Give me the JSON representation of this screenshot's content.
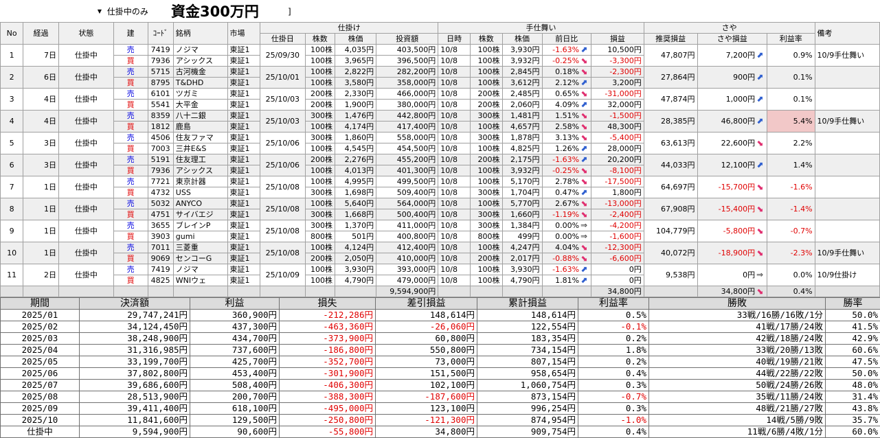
{
  "toolbar": {
    "filter_value": "仕掛中のみ",
    "caption": "資金300万円",
    "filter_right": "]"
  },
  "headers": {
    "no": "No",
    "elapsed": "経過",
    "status": "状態",
    "side": "建",
    "code": "ｺｰﾄﾞ",
    "name": "銘柄",
    "market": "市場",
    "grp_open": "仕掛け",
    "grp_close": "手仕舞い",
    "grp_spread": "さや",
    "open_date": "仕掛日",
    "open_qty": "株数",
    "open_price": "株価",
    "invest": "投資額",
    "close_time": "日時",
    "close_qty": "株数",
    "close_price": "株価",
    "day_change": "前日比",
    "pl": "損益",
    "rec_pl": "推奨損益",
    "spread_pl": "さや損益",
    "rate": "利益率",
    "memo": "備考"
  },
  "positions": [
    {
      "no": "1",
      "elapsed": "7日",
      "status": "仕掛中",
      "open_date": "25/09/30",
      "rec_pl": "47,807円",
      "spread_pl": "7,200円",
      "spread_dir": "up",
      "rate": "0.9%",
      "memo": "10/9手仕舞い",
      "highlight": false,
      "legs": [
        {
          "side": "売",
          "code": "7419",
          "name": "ノジマ",
          "market": "東証1",
          "qty": "100株",
          "price": "4,035円",
          "invest": "403,500円",
          "ctime": "10/8",
          "cqty": "100株",
          "cprice": "3,930円",
          "chg": "-1.63%",
          "dir": "up",
          "pl": "10,500円"
        },
        {
          "side": "買",
          "code": "7936",
          "name": "アシックス",
          "market": "東証1",
          "qty": "100株",
          "price": "3,965円",
          "invest": "396,500円",
          "ctime": "10/8",
          "cqty": "100株",
          "cprice": "3,932円",
          "chg": "-0.25%",
          "dir": "down",
          "pl": "-3,300円"
        }
      ]
    },
    {
      "no": "2",
      "elapsed": "6日",
      "status": "仕掛中",
      "open_date": "25/10/01",
      "rec_pl": "27,864円",
      "spread_pl": "900円",
      "spread_dir": "up",
      "rate": "0.1%",
      "memo": "",
      "highlight": false,
      "legs": [
        {
          "side": "売",
          "code": "5715",
          "name": "古河機金",
          "market": "東証1",
          "qty": "100株",
          "price": "2,822円",
          "invest": "282,200円",
          "ctime": "10/8",
          "cqty": "100株",
          "cprice": "2,845円",
          "chg": "0.18%",
          "dir": "down",
          "pl": "-2,300円"
        },
        {
          "side": "買",
          "code": "8795",
          "name": "T&DHD",
          "market": "東証1",
          "qty": "100株",
          "price": "3,580円",
          "invest": "358,000円",
          "ctime": "10/8",
          "cqty": "100株",
          "cprice": "3,612円",
          "chg": "2.12%",
          "dir": "up",
          "pl": "3,200円"
        }
      ]
    },
    {
      "no": "3",
      "elapsed": "4日",
      "status": "仕掛中",
      "open_date": "25/10/03",
      "rec_pl": "47,874円",
      "spread_pl": "1,000円",
      "spread_dir": "up",
      "rate": "0.1%",
      "memo": "",
      "highlight": false,
      "legs": [
        {
          "side": "売",
          "code": "6101",
          "name": "ツガミ",
          "market": "東証1",
          "qty": "200株",
          "price": "2,330円",
          "invest": "466,000円",
          "ctime": "10/8",
          "cqty": "200株",
          "cprice": "2,485円",
          "chg": "0.65%",
          "dir": "down",
          "pl": "-31,000円"
        },
        {
          "side": "買",
          "code": "5541",
          "name": "大平金",
          "market": "東証1",
          "qty": "200株",
          "price": "1,900円",
          "invest": "380,000円",
          "ctime": "10/8",
          "cqty": "200株",
          "cprice": "2,060円",
          "chg": "4.09%",
          "dir": "up",
          "pl": "32,000円"
        }
      ]
    },
    {
      "no": "4",
      "elapsed": "4日",
      "status": "仕掛中",
      "open_date": "25/10/03",
      "rec_pl": "28,385円",
      "spread_pl": "46,800円",
      "spread_dir": "up",
      "rate": "5.4%",
      "memo": "10/9手仕舞い",
      "highlight": true,
      "legs": [
        {
          "side": "売",
          "code": "8359",
          "name": "八十二銀",
          "market": "東証1",
          "qty": "300株",
          "price": "1,476円",
          "invest": "442,800円",
          "ctime": "10/8",
          "cqty": "300株",
          "cprice": "1,481円",
          "chg": "1.51%",
          "dir": "down",
          "pl": "-1,500円"
        },
        {
          "side": "買",
          "code": "1812",
          "name": "鹿島",
          "market": "東証1",
          "qty": "100株",
          "price": "4,174円",
          "invest": "417,400円",
          "ctime": "10/8",
          "cqty": "100株",
          "cprice": "4,657円",
          "chg": "2.58%",
          "dir": "down",
          "pl": "48,300円"
        }
      ]
    },
    {
      "no": "5",
      "elapsed": "3日",
      "status": "仕掛中",
      "open_date": "25/10/06",
      "rec_pl": "63,613円",
      "spread_pl": "22,600円",
      "spread_dir": "down",
      "rate": "2.2%",
      "memo": "",
      "highlight": false,
      "legs": [
        {
          "side": "売",
          "code": "4506",
          "name": "住友ファマ",
          "market": "東証1",
          "qty": "300株",
          "price": "1,860円",
          "invest": "558,000円",
          "ctime": "10/8",
          "cqty": "300株",
          "cprice": "1,878円",
          "chg": "3.13%",
          "dir": "down",
          "pl": "-5,400円"
        },
        {
          "side": "買",
          "code": "7003",
          "name": "三井E&S",
          "market": "東証1",
          "qty": "100株",
          "price": "4,545円",
          "invest": "454,500円",
          "ctime": "10/8",
          "cqty": "100株",
          "cprice": "4,825円",
          "chg": "1.26%",
          "dir": "up",
          "pl": "28,000円"
        }
      ]
    },
    {
      "no": "6",
      "elapsed": "3日",
      "status": "仕掛中",
      "open_date": "25/10/06",
      "rec_pl": "44,033円",
      "spread_pl": "12,100円",
      "spread_dir": "up",
      "rate": "1.4%",
      "memo": "",
      "highlight": false,
      "legs": [
        {
          "side": "売",
          "code": "5191",
          "name": "住友理工",
          "market": "東証1",
          "qty": "200株",
          "price": "2,276円",
          "invest": "455,200円",
          "ctime": "10/8",
          "cqty": "200株",
          "cprice": "2,175円",
          "chg": "-1.63%",
          "dir": "up",
          "pl": "20,200円"
        },
        {
          "side": "買",
          "code": "7936",
          "name": "アシックス",
          "market": "東証1",
          "qty": "100株",
          "price": "4,013円",
          "invest": "401,300円",
          "ctime": "10/8",
          "cqty": "100株",
          "cprice": "3,932円",
          "chg": "-0.25%",
          "dir": "down",
          "pl": "-8,100円"
        }
      ]
    },
    {
      "no": "7",
      "elapsed": "1日",
      "status": "仕掛中",
      "open_date": "25/10/08",
      "rec_pl": "64,697円",
      "spread_pl": "-15,700円",
      "spread_dir": "down",
      "rate": "-1.6%",
      "memo": "",
      "highlight": false,
      "legs": [
        {
          "side": "売",
          "code": "7721",
          "name": "東京計器",
          "market": "東証1",
          "qty": "100株",
          "price": "4,995円",
          "invest": "499,500円",
          "ctime": "10/8",
          "cqty": "100株",
          "cprice": "5,170円",
          "chg": "2.78%",
          "dir": "down",
          "pl": "-17,500円"
        },
        {
          "side": "買",
          "code": "4732",
          "name": "USS",
          "market": "東証1",
          "qty": "300株",
          "price": "1,698円",
          "invest": "509,400円",
          "ctime": "10/8",
          "cqty": "300株",
          "cprice": "1,704円",
          "chg": "0.47%",
          "dir": "up",
          "pl": "1,800円"
        }
      ]
    },
    {
      "no": "8",
      "elapsed": "1日",
      "status": "仕掛中",
      "open_date": "25/10/08",
      "rec_pl": "67,908円",
      "spread_pl": "-15,400円",
      "spread_dir": "down",
      "rate": "-1.4%",
      "memo": "",
      "highlight": false,
      "legs": [
        {
          "side": "売",
          "code": "5032",
          "name": "ANYCO",
          "market": "東証1",
          "qty": "100株",
          "price": "5,640円",
          "invest": "564,000円",
          "ctime": "10/8",
          "cqty": "100株",
          "cprice": "5,770円",
          "chg": "2.67%",
          "dir": "down",
          "pl": "-13,000円"
        },
        {
          "side": "買",
          "code": "4751",
          "name": "サイバエジ",
          "market": "東証1",
          "qty": "300株",
          "price": "1,668円",
          "invest": "500,400円",
          "ctime": "10/8",
          "cqty": "300株",
          "cprice": "1,660円",
          "chg": "-1.19%",
          "dir": "down",
          "pl": "-2,400円"
        }
      ]
    },
    {
      "no": "9",
      "elapsed": "1日",
      "status": "仕掛中",
      "open_date": "25/10/08",
      "rec_pl": "104,779円",
      "spread_pl": "-5,800円",
      "spread_dir": "down",
      "rate": "-0.7%",
      "memo": "",
      "highlight": false,
      "legs": [
        {
          "side": "売",
          "code": "3655",
          "name": "ブレインP",
          "market": "東証1",
          "qty": "300株",
          "price": "1,370円",
          "invest": "411,000円",
          "ctime": "10/8",
          "cqty": "300株",
          "cprice": "1,384円",
          "chg": "0.00%",
          "dir": "flat",
          "pl": "-4,200円"
        },
        {
          "side": "買",
          "code": "3903",
          "name": "gumi",
          "market": "東証1",
          "qty": "800株",
          "price": "501円",
          "invest": "400,800円",
          "ctime": "10/8",
          "cqty": "800株",
          "cprice": "499円",
          "chg": "0.00%",
          "dir": "flat",
          "pl": "-1,600円"
        }
      ]
    },
    {
      "no": "10",
      "elapsed": "1日",
      "status": "仕掛中",
      "open_date": "25/10/08",
      "rec_pl": "40,072円",
      "spread_pl": "-18,900円",
      "spread_dir": "down",
      "rate": "-2.3%",
      "memo": "10/9手仕舞い",
      "highlight": false,
      "legs": [
        {
          "side": "売",
          "code": "7011",
          "name": "三菱重",
          "market": "東証1",
          "qty": "100株",
          "price": "4,124円",
          "invest": "412,400円",
          "ctime": "10/8",
          "cqty": "100株",
          "cprice": "4,247円",
          "chg": "4.04%",
          "dir": "down",
          "pl": "-12,300円"
        },
        {
          "side": "買",
          "code": "9069",
          "name": "センコーG",
          "market": "東証1",
          "qty": "200株",
          "price": "2,050円",
          "invest": "410,000円",
          "ctime": "10/8",
          "cqty": "200株",
          "cprice": "2,017円",
          "chg": "-0.88%",
          "dir": "down",
          "pl": "-6,600円"
        }
      ]
    },
    {
      "no": "11",
      "elapsed": "2日",
      "status": "仕掛中",
      "open_date": "25/10/09",
      "rec_pl": "9,538円",
      "spread_pl": "0円",
      "spread_dir": "flat",
      "rate": "0.0%",
      "memo": "10/9仕掛け",
      "highlight": false,
      "legs": [
        {
          "side": "売",
          "code": "7419",
          "name": "ノジマ",
          "market": "東証1",
          "qty": "100株",
          "price": "3,930円",
          "invest": "393,000円",
          "ctime": "10/8",
          "cqty": "100株",
          "cprice": "3,930円",
          "chg": "-1.63%",
          "dir": "up",
          "pl": "0円"
        },
        {
          "side": "買",
          "code": "4825",
          "name": "WNIウェ",
          "market": "東証1",
          "qty": "100株",
          "price": "4,790円",
          "invest": "479,000円",
          "ctime": "10/8",
          "cqty": "100株",
          "cprice": "4,790円",
          "chg": "1.81%",
          "dir": "up",
          "pl": "0円"
        }
      ]
    }
  ],
  "totals": {
    "invest": "9,594,900円",
    "pl": "34,800円",
    "spread_pl": "34,800円",
    "spread_dir": "down",
    "rate": "0.4%"
  },
  "summary_headers": {
    "period": "期間",
    "settle": "決済額",
    "profit": "利益",
    "loss": "損失",
    "net": "差引損益",
    "cum": "累計損益",
    "rate": "利益率",
    "record": "勝敗",
    "winrate": "勝率"
  },
  "summary_rows": [
    {
      "period": "2025/01",
      "settle": "29,747,241円",
      "profit": "360,900円",
      "loss": "-212,286円",
      "net": "148,614円",
      "cum": "148,614円",
      "rate": "0.5%",
      "record": "33戦/16勝/16敗/1分",
      "winrate": "50.0%"
    },
    {
      "period": "2025/02",
      "settle": "34,124,450円",
      "profit": "437,300円",
      "loss": "-463,360円",
      "net": "-26,060円",
      "cum": "122,554円",
      "rate": "-0.1%",
      "record": "41戦/17勝/24敗",
      "winrate": "41.5%"
    },
    {
      "period": "2025/03",
      "settle": "38,248,900円",
      "profit": "434,700円",
      "loss": "-373,900円",
      "net": "60,800円",
      "cum": "183,354円",
      "rate": "0.2%",
      "record": "42戦/18勝/24敗",
      "winrate": "42.9%"
    },
    {
      "period": "2025/04",
      "settle": "31,316,985円",
      "profit": "737,600円",
      "loss": "-186,800円",
      "net": "550,800円",
      "cum": "734,154円",
      "rate": "1.8%",
      "record": "33戦/20勝/13敗",
      "winrate": "60.6%"
    },
    {
      "period": "2025/05",
      "settle": "33,199,700円",
      "profit": "425,700円",
      "loss": "-352,700円",
      "net": "73,000円",
      "cum": "807,154円",
      "rate": "0.2%",
      "record": "40戦/19勝/21敗",
      "winrate": "47.5%"
    },
    {
      "period": "2025/06",
      "settle": "37,802,800円",
      "profit": "453,400円",
      "loss": "-301,900円",
      "net": "151,500円",
      "cum": "958,654円",
      "rate": "0.4%",
      "record": "44戦/22勝/22敗",
      "winrate": "50.0%"
    },
    {
      "period": "2025/07",
      "settle": "39,686,600円",
      "profit": "508,400円",
      "loss": "-406,300円",
      "net": "102,100円",
      "cum": "1,060,754円",
      "rate": "0.3%",
      "record": "50戦/24勝/26敗",
      "winrate": "48.0%"
    },
    {
      "period": "2025/08",
      "settle": "28,513,900円",
      "profit": "200,700円",
      "loss": "-388,300円",
      "net": "-187,600円",
      "cum": "873,154円",
      "rate": "-0.7%",
      "record": "35戦/11勝/24敗",
      "winrate": "31.4%"
    },
    {
      "period": "2025/09",
      "settle": "39,411,400円",
      "profit": "618,100円",
      "loss": "-495,000円",
      "net": "123,100円",
      "cum": "996,254円",
      "rate": "0.3%",
      "record": "48戦/21勝/27敗",
      "winrate": "43.8%"
    },
    {
      "period": "2025/10",
      "settle": "11,841,600円",
      "profit": "129,500円",
      "loss": "-250,800円",
      "net": "-121,300円",
      "cum": "874,954円",
      "rate": "-1.0%",
      "record": "14戦/5勝/9敗",
      "winrate": "35.7%"
    },
    {
      "period": "仕掛中",
      "settle": "9,594,900円",
      "profit": "90,600円",
      "loss": "-55,800円",
      "net": "34,800円",
      "cum": "909,754円",
      "rate": "0.4%",
      "record": "11戦/6勝/4敗/1分",
      "winrate": "60.0%"
    }
  ],
  "colors": {
    "sell": "#0000e0",
    "negative": "#e00000",
    "arrow_up": "#3060d0",
    "arrow_down": "#e03070",
    "highlight": "#f2c8c8"
  }
}
